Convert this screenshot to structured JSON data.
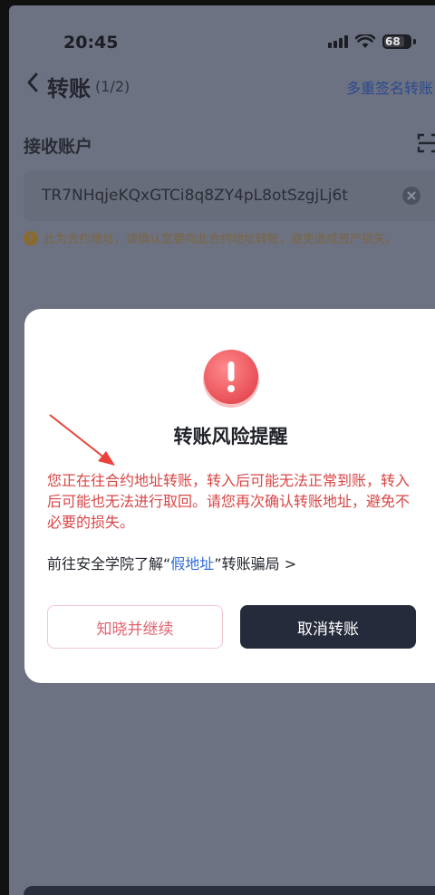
{
  "status_bar": {
    "time": "20:45",
    "battery": "68"
  },
  "header": {
    "title": "转账",
    "step": "(1/2)",
    "multisig_link": "多重签名转账"
  },
  "receive": {
    "label": "接收账户",
    "address": "TR7NHqjeKQxGTCi8q8ZY4pL8otSzgjLj6t",
    "warning": "此为合约地址，请确认您要向此合约地址转账，避免造成资产损失。"
  },
  "modal": {
    "title": "转账风险提醒",
    "message": "您正在往合约地址转账，转入后可能无法正常到账，转入后可能也无法进行取回。请您再次确认转账地址，避免不必要的损失。",
    "learn_prefix": "前往安全学院了解“",
    "learn_link": "假地址",
    "learn_suffix": "”转账骗局 >",
    "continue_label": "知晓并继续",
    "cancel_label": "取消转账"
  },
  "colors": {
    "overlay": "#6d7282",
    "warning_red": "#d94545",
    "link_blue": "#2f6bd6",
    "cancel_button": "#262b3b",
    "continue_text": "#e36472"
  },
  "icons": [
    "back-icon",
    "scan-icon",
    "clear-icon",
    "warning-icon",
    "alert-icon",
    "signal-icon",
    "wifi-icon",
    "battery-icon"
  ]
}
